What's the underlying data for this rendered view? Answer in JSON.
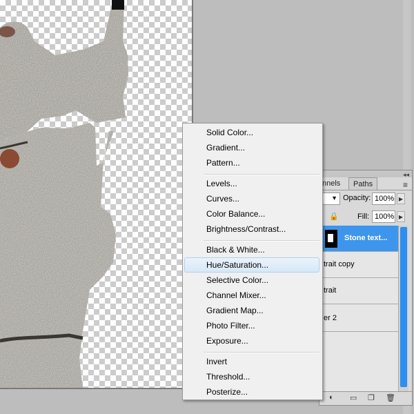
{
  "layers_panel": {
    "tabs": [
      "nnels",
      "Paths"
    ],
    "opacity_label": "Opacity:",
    "opacity_value": "100%",
    "fill_label": "Fill:",
    "fill_value": "100%",
    "layers": [
      {
        "name": "Stone text...",
        "selected": true
      },
      {
        "name": "trait copy",
        "selected": false
      },
      {
        "name": "trait",
        "selected": false
      },
      {
        "name": "er 2",
        "selected": false
      }
    ],
    "icons": [
      "adjustment-layer-icon",
      "folder-icon",
      "new-layer-icon",
      "trash-icon",
      "lock-icon"
    ]
  },
  "context_menu": {
    "items": [
      {
        "label": "Solid Color..."
      },
      {
        "label": "Gradient..."
      },
      {
        "label": "Pattern..."
      },
      {
        "label": "Levels..."
      },
      {
        "label": "Curves..."
      },
      {
        "label": "Color Balance..."
      },
      {
        "label": "Brightness/Contrast..."
      },
      {
        "label": "Black & White..."
      },
      {
        "label": "Hue/Saturation...",
        "highlighted": true
      },
      {
        "label": "Selective Color..."
      },
      {
        "label": "Channel Mixer..."
      },
      {
        "label": "Gradient Map..."
      },
      {
        "label": "Photo Filter..."
      },
      {
        "label": "Exposure..."
      },
      {
        "label": "Invert"
      },
      {
        "label": "Threshold..."
      },
      {
        "label": "Posterize..."
      }
    ]
  },
  "colors": {
    "selection_blue": "#3d96ec",
    "workspace_gray": "#bdbdbd",
    "menu_background": "#f0f0f0",
    "stone_texture": "#9b9790"
  }
}
